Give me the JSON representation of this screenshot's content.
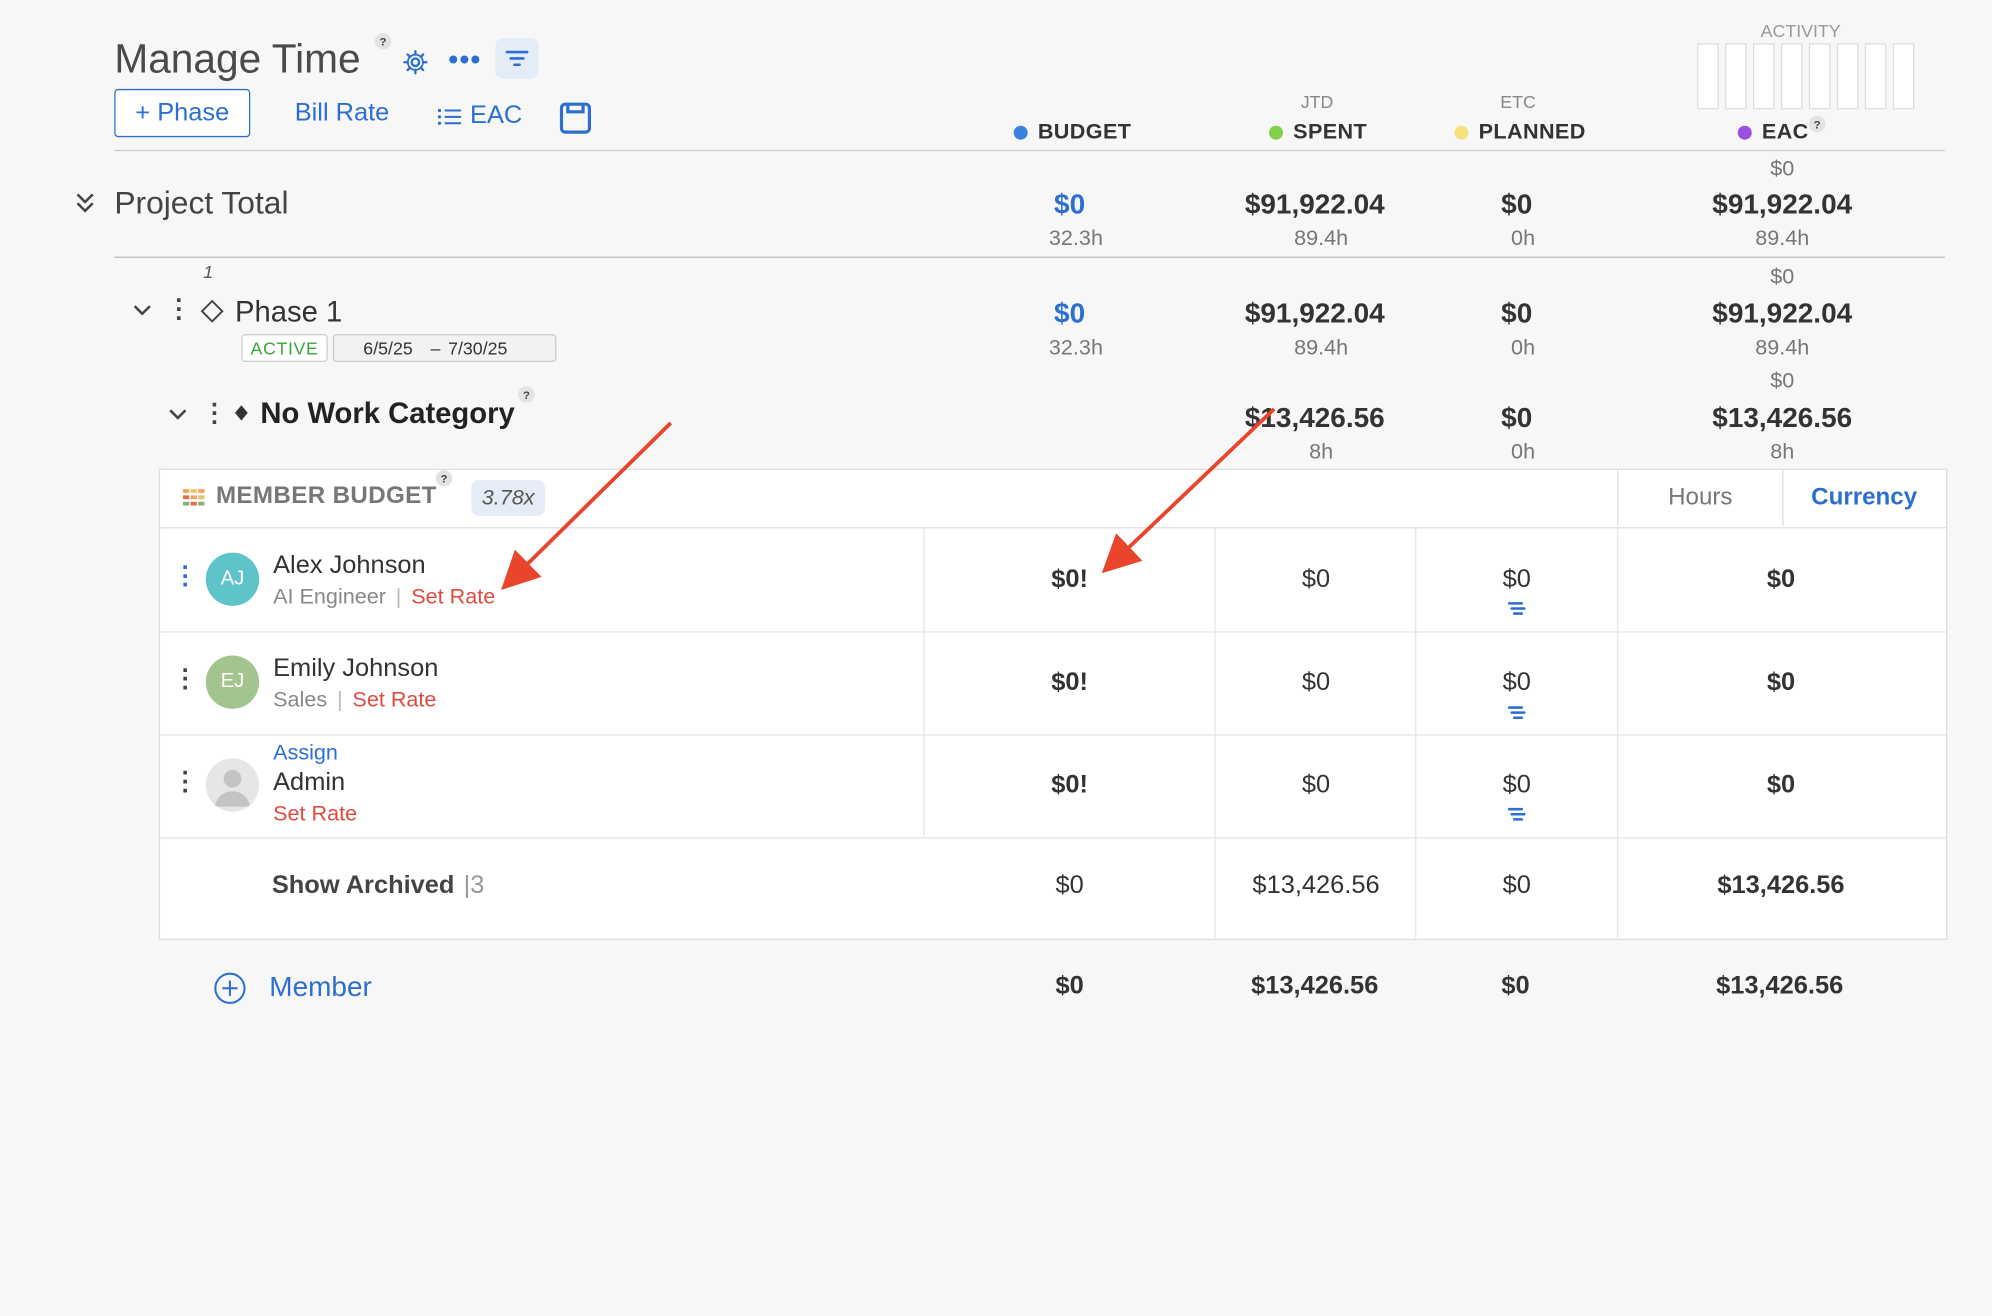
{
  "header": {
    "title": "Manage Time",
    "help": "?",
    "phase_button": "+ Phase",
    "bill_rate": "Bill Rate",
    "eac_link": "EAC"
  },
  "columns": {
    "budget": {
      "label": "BUDGET",
      "color": "#3b82e0"
    },
    "spent": {
      "sup": "JTD",
      "label": "SPENT",
      "color": "#7fd14a"
    },
    "planned": {
      "sup": "ETC",
      "label": "PLANNED",
      "color": "#f5e27a"
    },
    "eac": {
      "label": "EAC",
      "color": "#9b51e0"
    }
  },
  "activity": {
    "label": "ACTIVITY"
  },
  "project_total": {
    "label": "Project Total",
    "budget": "$0",
    "budget_hours": "32.3h",
    "spent": "$91,922.04",
    "spent_hours": "89.4h",
    "planned": "$0",
    "planned_hours": "0h",
    "eac_top": "$0",
    "eac": "$91,922.04",
    "eac_hours": "89.4h"
  },
  "phase": {
    "number": "1",
    "name": "Phase 1",
    "status": "ACTIVE",
    "start": "6/5/25",
    "dash": "–",
    "end": "7/30/25",
    "budget": "$0",
    "budget_hours": "32.3h",
    "spent": "$91,922.04",
    "spent_hours": "89.4h",
    "planned": "$0",
    "planned_hours": "0h",
    "eac_top": "$0",
    "eac": "$91,922.04",
    "eac_hours": "89.4h"
  },
  "category": {
    "name": "No Work Category",
    "spent": "$13,426.56",
    "spent_hours": "8h",
    "planned": "$0",
    "planned_hours": "0h",
    "eac_top": "$0",
    "eac": "$13,426.56",
    "eac_hours": "8h"
  },
  "member_budget": {
    "label": "MEMBER BUDGET",
    "multiplier": "3.78x",
    "toggle_hours": "Hours",
    "toggle_currency": "Currency"
  },
  "members": [
    {
      "initials": "AJ",
      "name": "Alex Johnson",
      "role": "AI Engineer",
      "sep": "|",
      "set_rate": "Set Rate",
      "budget": "$0!",
      "spent": "$0",
      "planned": "$0",
      "eac": "$0",
      "avatar_color": "#5ec4c9"
    },
    {
      "initials": "EJ",
      "name": "Emily Johnson",
      "role": "Sales",
      "sep": "|",
      "set_rate": "Set Rate",
      "budget": "$0!",
      "spent": "$0",
      "planned": "$0",
      "eac": "$0",
      "avatar_color": "#a3c48f"
    },
    {
      "assign": "Assign",
      "name": "Admin",
      "set_rate": "Set Rate",
      "budget": "$0!",
      "spent": "$0",
      "planned": "$0",
      "eac": "$0"
    }
  ],
  "archived": {
    "label": "Show Archived",
    "count": "|3",
    "budget": "$0",
    "spent": "$13,426.56",
    "planned": "$0",
    "eac": "$13,426.56"
  },
  "footer": {
    "member_label": "Member",
    "budget": "$0",
    "spent": "$13,426.56",
    "planned": "$0",
    "eac": "$13,426.56"
  }
}
